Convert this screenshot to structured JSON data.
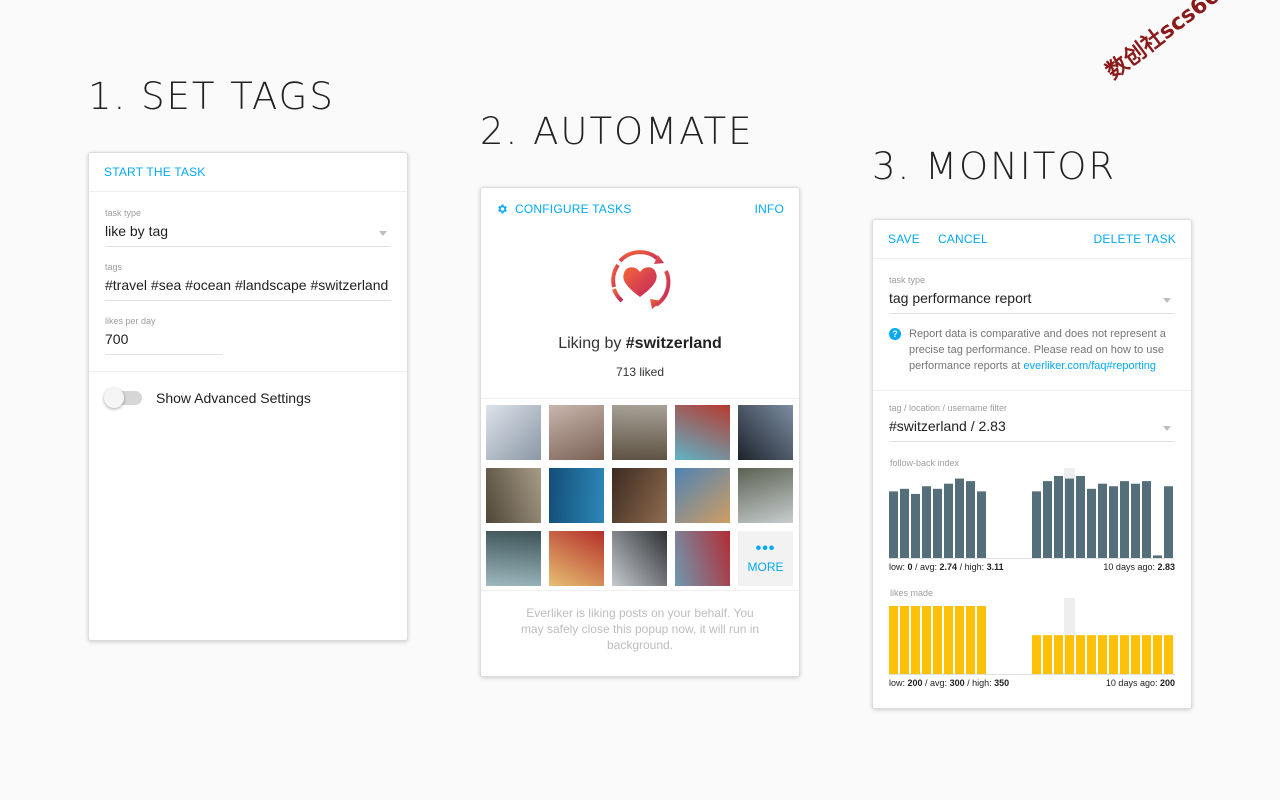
{
  "steps": {
    "set_tags": "1. SET TAGS",
    "automate": "2. AUTOMATE",
    "monitor": "3. MONITOR"
  },
  "watermark": "数创社scs66",
  "card1": {
    "header_link": "START THE TASK",
    "task_type": {
      "label": "task type",
      "value": "like by tag"
    },
    "tags": {
      "label": "tags",
      "value": "#travel #sea #ocean #landscape #switzerland"
    },
    "likes_per_day": {
      "label": "likes per day",
      "value": "700"
    },
    "advanced_toggle": {
      "label": "Show Advanced Settings",
      "on": false
    }
  },
  "card2": {
    "configure_link": "CONFIGURE TASKS",
    "info_link": "INFO",
    "liking_prefix": "Liking by ",
    "liking_tag": "#switzerland",
    "liked_count": "713 liked",
    "more_label": "MORE",
    "more_dots": "•••",
    "note": "Everliker is liking posts on your behalf. You may safely close this popup now, it will run in background.",
    "thumbnails": [
      {
        "name": "snowy-forest",
        "c1": "#dde3ea",
        "c2": "#8a97a5"
      },
      {
        "name": "person-on-ice",
        "c1": "#c9b6ad",
        "c2": "#7a6156"
      },
      {
        "name": "town-view",
        "c1": "#a7a197",
        "c2": "#5e5243"
      },
      {
        "name": "swiss-knives",
        "c1": "#b73a2f",
        "c2": "#5fb3c7"
      },
      {
        "name": "mountain-village",
        "c1": "#7d8da3",
        "c2": "#1d232c"
      },
      {
        "name": "old-street",
        "c1": "#a79c86",
        "c2": "#4f4638"
      },
      {
        "name": "blue-texture",
        "c1": "#2d87b8",
        "c2": "#134e77"
      },
      {
        "name": "rustic-room",
        "c1": "#8e6b50",
        "c2": "#3d2b20"
      },
      {
        "name": "cafe-interior",
        "c1": "#cf9d62",
        "c2": "#4f83b4"
      },
      {
        "name": "lake-sunset",
        "c1": "#c8cdd0",
        "c2": "#5c6251"
      },
      {
        "name": "pool-building",
        "c1": "#9db9bf",
        "c2": "#3c5257"
      },
      {
        "name": "chocolate-boxes",
        "c1": "#e7c072",
        "c2": "#b52f2a"
      },
      {
        "name": "snowy-balcony",
        "c1": "#c6cbcf",
        "c2": "#2f3134"
      },
      {
        "name": "lake-person",
        "c1": "#6f99b0",
        "c2": "#b32c36"
      }
    ]
  },
  "card3": {
    "save_link": "SAVE",
    "cancel_link": "CANCEL",
    "delete_link": "DELETE TASK",
    "task_type": {
      "label": "task type",
      "value": "tag performance report"
    },
    "info_text": "Report data is comparative and does not represent a precise tag performance. Please read on how to use performance reports at ",
    "info_link": "everliker.com/faq#reporting",
    "filter": {
      "label": "tag / location / username filter",
      "value": "#switzerland / 2.83"
    },
    "followback": {
      "label": "follow-back index",
      "low_label": "low: ",
      "low": "0",
      "avg_label": " / avg: ",
      "avg": "2.74",
      "high_label": " / high: ",
      "high": "3.11",
      "ago_label": "10 days ago: ",
      "ago": "2.83",
      "color": "#546e7a"
    },
    "likes_made": {
      "label": "likes made",
      "low_label": "low: ",
      "low": "200",
      "avg_label": " / avg: ",
      "avg": "300",
      "high_label": " / high: ",
      "high": "350",
      "ago_label": "10 days ago: ",
      "ago": "200",
      "color": "#ffc107"
    }
  },
  "chart_data": [
    {
      "type": "bar",
      "title": "follow-back index",
      "series": [
        {
          "values": [
            2.6,
            2.7,
            2.5,
            2.8,
            2.7,
            2.9,
            3.1,
            3.0,
            2.6,
            null,
            null,
            null,
            null,
            2.6,
            3.0,
            3.2,
            3.1,
            3.2,
            2.7,
            2.9,
            2.8,
            3.0,
            2.9,
            3.0,
            0.1,
            2.8
          ]
        }
      ],
      "highlight_index": 16,
      "ylim": [
        0,
        3.2
      ]
    },
    {
      "type": "bar",
      "title": "likes made",
      "series": [
        {
          "values": [
            350,
            350,
            350,
            350,
            350,
            350,
            350,
            350,
            350,
            null,
            null,
            null,
            null,
            200,
            200,
            200,
            200,
            200,
            200,
            200,
            200,
            200,
            200,
            200,
            200,
            200
          ]
        }
      ],
      "highlight_index": 16,
      "ylim": [
        0,
        350
      ]
    }
  ]
}
